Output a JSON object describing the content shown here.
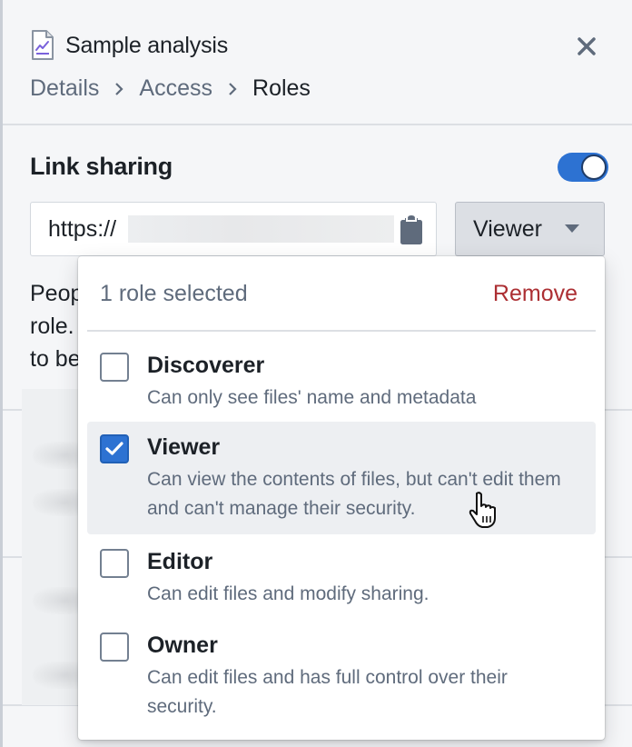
{
  "header": {
    "title": "Sample analysis",
    "icon": "analysis-document-icon",
    "close_icon": "close-icon",
    "breadcrumb": [
      {
        "label": "Details"
      },
      {
        "label": "Access"
      },
      {
        "label": "Roles"
      }
    ]
  },
  "link_sharing": {
    "title": "Link sharing",
    "enabled": true,
    "url_prefix": "https://",
    "copy_icon": "clipboard-icon",
    "role_select": {
      "selected": "Viewer",
      "icon": "caret-down-icon"
    },
    "description_partial": [
      "Peop",
      "role.",
      "to be"
    ]
  },
  "role_dropdown": {
    "selected_count_text": "1 role selected",
    "remove_label": "Remove",
    "options": [
      {
        "label": "Discoverer",
        "description": "Can only see files' name and metadata",
        "checked": false
      },
      {
        "label": "Viewer",
        "description": "Can view the contents of files, but can't edit them and can't manage their security.",
        "checked": true
      },
      {
        "label": "Editor",
        "description": "Can edit files and modify sharing.",
        "checked": false
      },
      {
        "label": "Owner",
        "description": "Can edit files and has full control over their security.",
        "checked": false
      }
    ]
  },
  "colors": {
    "accent": "#2d72d2",
    "danger": "#ac2f33",
    "muted_text": "#5f6b7c",
    "text": "#1c2127",
    "icon_purple": "#7961db"
  }
}
